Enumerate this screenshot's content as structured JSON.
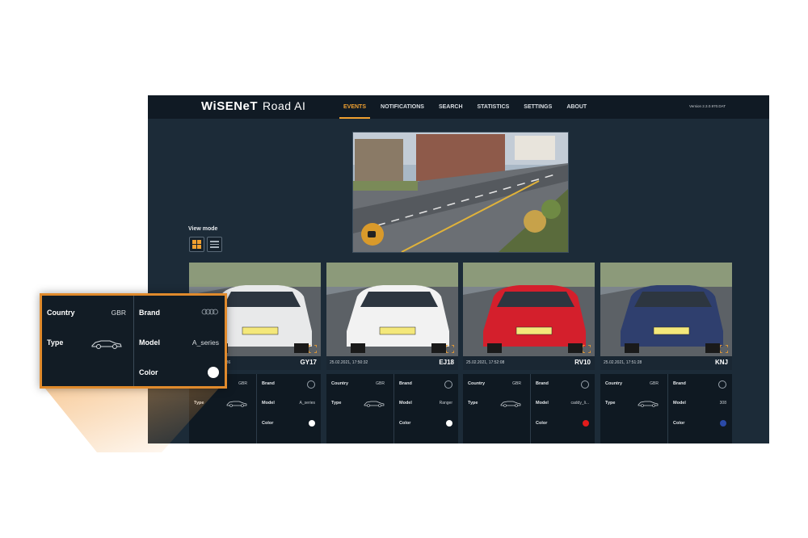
{
  "app": {
    "brand": "WiSENeT",
    "product": "Road AI",
    "version": "Version 2.3.0.970.DAT"
  },
  "nav": [
    "EVENTS",
    "NOTIFICATIONS",
    "SEARCH",
    "STATISTICS",
    "SETTINGS",
    "ABOUT"
  ],
  "nav_active": "EVENTS",
  "view_mode": {
    "label": "View mode",
    "selected": "grid"
  },
  "cards": [
    {
      "time": "25.02.2021, 17:50:36",
      "plate": "GY17",
      "country_label": "Country",
      "country": "GBR",
      "type_label": "Type",
      "brand_label": "Brand",
      "brand_icon": "audi-icon",
      "model_label": "Model",
      "model": "A_series",
      "color_label": "Color",
      "color": "#ffffff",
      "car_color": "#e8e9ea"
    },
    {
      "time": "25.02.2021, 17:50:32",
      "plate": "EJ18",
      "country_label": "Country",
      "country": "GBR",
      "type_label": "Type",
      "brand_label": "Brand",
      "brand_icon": "ford-icon",
      "model_label": "Model",
      "model": "Ranger",
      "color_label": "Color",
      "color": "#ffffff",
      "car_color": "#f2f2f2"
    },
    {
      "time": "25.02.2021, 17:52:08",
      "plate": "RV10",
      "country_label": "Country",
      "country": "GBR",
      "type_label": "Type",
      "brand_label": "Brand",
      "brand_icon": "volkswagen-icon",
      "model_label": "Model",
      "model": "caddy_li...",
      "color_label": "Color",
      "color": "#e21b1b",
      "car_color": "#d41f2c"
    },
    {
      "time": "25.02.2021, 17:51:28",
      "plate": "KNJ",
      "country_label": "Country",
      "country": "GBR",
      "type_label": "Type",
      "brand_label": "Brand",
      "brand_icon": "peugeot-icon",
      "model_label": "Model",
      "model": "308",
      "color_label": "Color",
      "color": "#2a4aa8",
      "car_color": "#2f3f6e"
    }
  ],
  "popup": {
    "country_label": "Country",
    "country": "GBR",
    "type_label": "Type",
    "brand_label": "Brand",
    "brand_icon": "audi-icon",
    "model_label": "Model",
    "model": "A_series",
    "color_label": "Color",
    "color": "#ffffff"
  },
  "colors": {
    "accent": "#f0a030",
    "background": "#1c2b38",
    "topbar": "#101a24",
    "popup_border": "#e08a2c"
  }
}
